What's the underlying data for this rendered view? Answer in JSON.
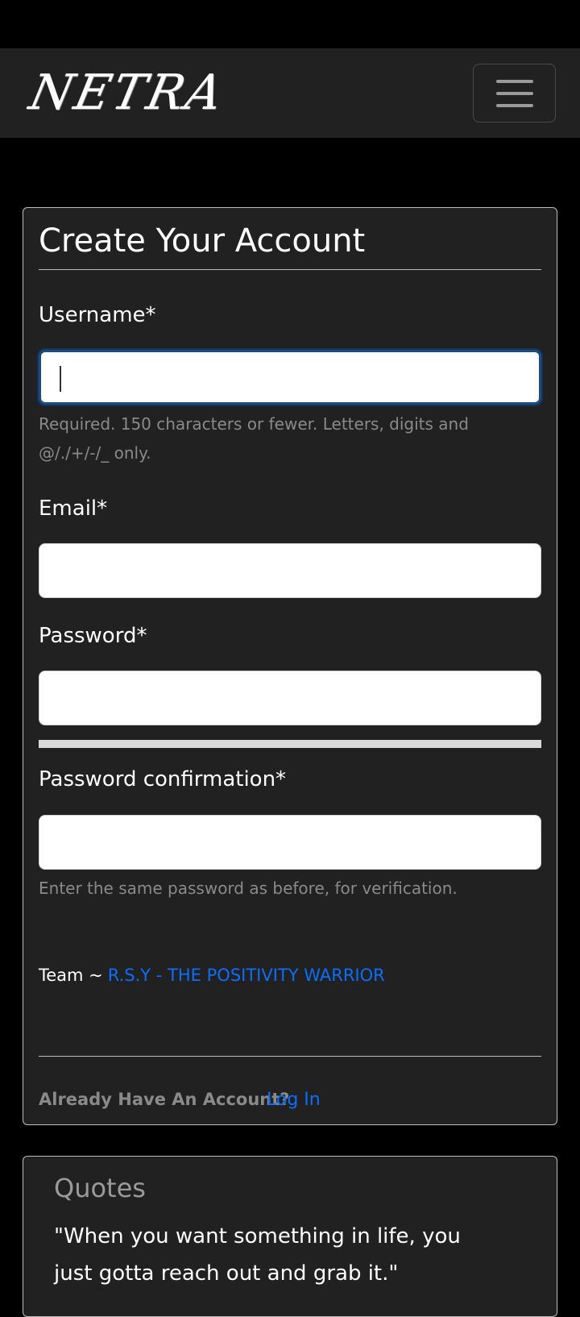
{
  "navbar": {
    "brand": "NETRA",
    "toggler_icon": "hamburger-icon"
  },
  "form": {
    "title": "Create Your Account",
    "username": {
      "label": "Username*",
      "value": "",
      "help": "Required. 150 characters or fewer. Letters, digits and @/./+/-/_ only."
    },
    "email": {
      "label": "Email*",
      "value": ""
    },
    "password": {
      "label": "Password*",
      "value": ""
    },
    "password_confirmation": {
      "label": "Password confirmation*",
      "value": "",
      "help": "Enter the same password as before, for verification."
    },
    "team_prefix": "Team ~",
    "team_name": "R.S.Y - THE POSITIVITY WARRIOR",
    "already_text": "Already Have An Account?",
    "login_link": "Log In"
  },
  "quotes": {
    "title": "Quotes",
    "text": "\"When you want something in life, you just gotta reach out and grab it.\""
  },
  "colors": {
    "background": "#000000",
    "card": "#212121",
    "link": "#0d6efd",
    "muted": "#8a8a8a"
  }
}
